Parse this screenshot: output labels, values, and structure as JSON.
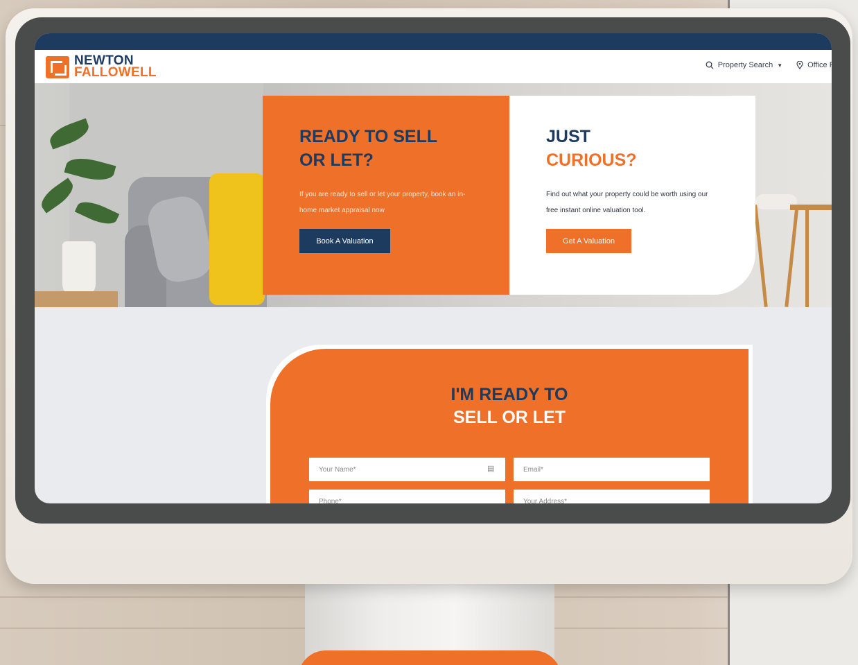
{
  "logo": {
    "line1": "NEWTON",
    "line2": "FALLOWELL"
  },
  "nav": {
    "search_icon": "search-icon",
    "property_search": "Property Search",
    "office_icon": "location-pin-icon",
    "office_finder": "Office Fin"
  },
  "hero": {
    "sell": {
      "title_line1": "READY TO SELL",
      "title_line2": "OR LET?",
      "text": "If you are ready to sell or let your property, book an in-home market appraisal now",
      "button": "Book A Valuation"
    },
    "curious": {
      "title_line1": "JUST",
      "title_line2": "CURIOUS?",
      "text": "Find out what your property could be worth using our free instant online valuation tool.",
      "button": "Get A Valuation"
    }
  },
  "form": {
    "title_line1": "I'M READY TO",
    "title_line2": "SELL OR LET",
    "name_placeholder": "Your Name*",
    "email_placeholder": "Email*",
    "phone_placeholder": "Phone*",
    "address_placeholder": "Your Address*"
  },
  "colors": {
    "orange": "#ee7029",
    "navy": "#1d3a5f"
  }
}
